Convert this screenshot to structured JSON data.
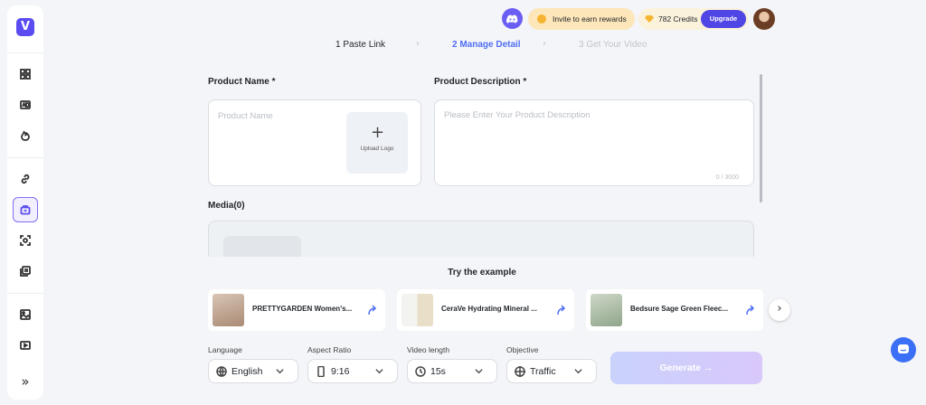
{
  "topbar": {
    "invite_label": "Invite to earn rewards",
    "credits_label": "782 Credits",
    "upgrade_label": "Upgrade"
  },
  "steps": [
    {
      "label": "1 Paste Link",
      "state": "done"
    },
    {
      "label": "2 Manage Detail",
      "state": "active"
    },
    {
      "label": "3 Get Your Video",
      "state": "pending"
    }
  ],
  "form": {
    "product_name_label": "Product Name *",
    "product_name_placeholder": "Product Name",
    "upload_logo_label": "Upload Logo",
    "product_description_label": "Product Description *",
    "product_description_placeholder": "Please Enter Your Product Description",
    "char_count": "0 / 3000",
    "media_label": "Media(0)"
  },
  "examples": {
    "title": "Try the example",
    "items": [
      {
        "name": "PRETTYGARDEN Women's..."
      },
      {
        "name": "CeraVe Hydrating Mineral ..."
      },
      {
        "name": "Bedsure Sage Green Fleec..."
      }
    ]
  },
  "options": {
    "language": {
      "label": "Language",
      "value": "English",
      "icon": "globe-icon"
    },
    "aspect_ratio": {
      "label": "Aspect Ratio",
      "value": "9:16",
      "icon": "phone-icon"
    },
    "video_length": {
      "label": "Video length",
      "value": "15s",
      "icon": "clock-icon"
    },
    "objective": {
      "label": "Objective",
      "value": "Traffic",
      "icon": "crosshair-icon"
    }
  },
  "generate_label": "Generate →",
  "colors": {
    "accent": "#4f46e5",
    "active_step": "#4f6ef5",
    "invite_bg": "#fde6b9",
    "generate_gradient_start": "#c9d2fb"
  }
}
